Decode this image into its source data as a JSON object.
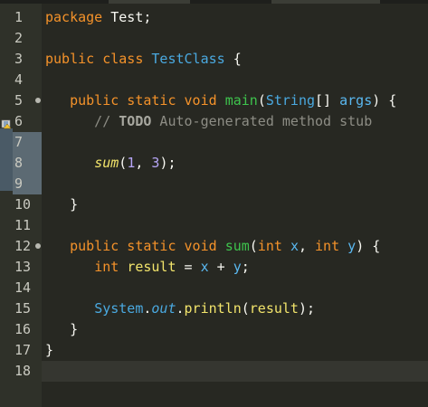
{
  "lines": [
    {
      "n": "1",
      "fold": false,
      "segs": [
        [
          "kw",
          "package"
        ],
        [
          "pl",
          " Test;"
        ]
      ]
    },
    {
      "n": "2",
      "fold": false,
      "segs": []
    },
    {
      "n": "3",
      "fold": false,
      "segs": [
        [
          "kw",
          "public class"
        ],
        [
          "pl",
          " "
        ],
        [
          "cls",
          "TestClass"
        ],
        [
          "pl",
          " {"
        ]
      ]
    },
    {
      "n": "4",
      "fold": false,
      "segs": []
    },
    {
      "n": "5",
      "fold": true,
      "segs": [
        [
          "pl",
          "   "
        ],
        [
          "kw",
          "public static void"
        ],
        [
          "pl",
          " "
        ],
        [
          "fn",
          "main"
        ],
        [
          "pl",
          "("
        ],
        [
          "cls",
          "String"
        ],
        [
          "pl",
          "[] "
        ],
        [
          "param",
          "args"
        ],
        [
          "pl",
          ") {"
        ]
      ]
    },
    {
      "n": "6",
      "fold": false,
      "segs": [
        [
          "cm",
          "      // "
        ],
        [
          "todo",
          "TODO"
        ],
        [
          "cm",
          " Auto-generated method stub"
        ]
      ]
    },
    {
      "n": "7",
      "fold": false,
      "segs": []
    },
    {
      "n": "8",
      "fold": false,
      "segs": [
        [
          "pl",
          "      "
        ],
        [
          "call ital",
          "sum"
        ],
        [
          "pl",
          "("
        ],
        [
          "num",
          "1"
        ],
        [
          "pl",
          ", "
        ],
        [
          "num",
          "3"
        ],
        [
          "pl",
          ");"
        ]
      ]
    },
    {
      "n": "9",
      "fold": false,
      "segs": []
    },
    {
      "n": "10",
      "fold": false,
      "segs": [
        [
          "pl",
          "   }"
        ]
      ]
    },
    {
      "n": "11",
      "fold": false,
      "segs": []
    },
    {
      "n": "12",
      "fold": true,
      "segs": [
        [
          "pl",
          "   "
        ],
        [
          "kw",
          "public static void"
        ],
        [
          "pl",
          " "
        ],
        [
          "fn",
          "sum"
        ],
        [
          "pl",
          "("
        ],
        [
          "kw",
          "int"
        ],
        [
          "pl",
          " "
        ],
        [
          "param",
          "x"
        ],
        [
          "pl",
          ", "
        ],
        [
          "kw",
          "int"
        ],
        [
          "pl",
          " "
        ],
        [
          "param",
          "y"
        ],
        [
          "pl",
          ") {"
        ]
      ]
    },
    {
      "n": "13",
      "fold": false,
      "segs": [
        [
          "pl",
          "      "
        ],
        [
          "kw",
          "int"
        ],
        [
          "pl",
          " "
        ],
        [
          "var",
          "result"
        ],
        [
          "pl",
          " = "
        ],
        [
          "param",
          "x"
        ],
        [
          "pl",
          " + "
        ],
        [
          "param",
          "y"
        ],
        [
          "pl",
          ";"
        ]
      ]
    },
    {
      "n": "14",
      "fold": false,
      "segs": []
    },
    {
      "n": "15",
      "fold": false,
      "segs": [
        [
          "pl",
          "      "
        ],
        [
          "cls",
          "System"
        ],
        [
          "pl",
          "."
        ],
        [
          "fld",
          "out"
        ],
        [
          "pl",
          "."
        ],
        [
          "call",
          "println"
        ],
        [
          "pl",
          "("
        ],
        [
          "var",
          "result"
        ],
        [
          "pl",
          ");"
        ]
      ]
    },
    {
      "n": "16",
      "fold": false,
      "segs": [
        [
          "pl",
          "   }"
        ]
      ]
    },
    {
      "n": "17",
      "fold": false,
      "segs": [
        [
          "pl",
          "}"
        ]
      ]
    },
    {
      "n": "18",
      "fold": false,
      "segs": []
    }
  ],
  "selected_lines": [
    "7",
    "8",
    "9"
  ],
  "current_line": "18",
  "warning_line": "6",
  "icons": {
    "fold_marker": "fold-circle-icon",
    "warning": "warning-icon"
  }
}
